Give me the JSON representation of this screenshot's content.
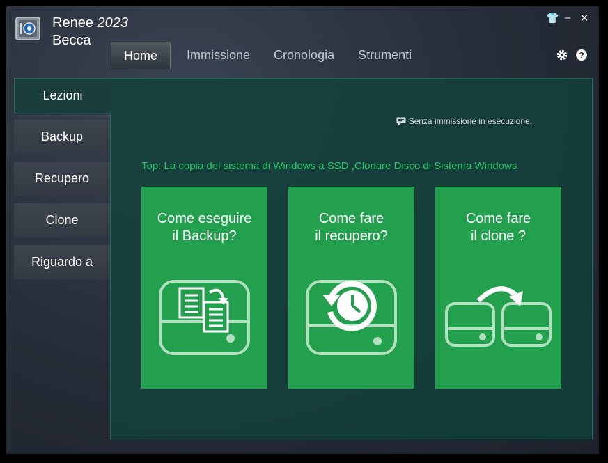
{
  "app": {
    "name_line1": "Renee",
    "version": "2023",
    "name_line2": "Becca"
  },
  "window_controls": {
    "shirt": "👕",
    "minimize": "–",
    "close": "✕"
  },
  "tabs": [
    {
      "label": "Home",
      "active": true
    },
    {
      "label": "Immissione"
    },
    {
      "label": "Cronologia"
    },
    {
      "label": "Strumenti"
    }
  ],
  "sidebar": {
    "header": "Lezioni",
    "items": [
      {
        "label": "Backup"
      },
      {
        "label": "Recupero"
      },
      {
        "label": "Clone"
      },
      {
        "label": "Riguardo a"
      }
    ]
  },
  "status": {
    "text": "Senza immissione in esecuzione."
  },
  "top_line": "Top: La copia del sistema di Windows a SSD ,Clonare Disco di Sistema Windows",
  "cards": [
    {
      "line1": "Come eseguire",
      "line2": "il Backup?",
      "icon": "backup-drive-icon"
    },
    {
      "line1": "Come fare",
      "line2": "il recupero?",
      "icon": "restore-drive-icon"
    },
    {
      "line1": "Come fare",
      "line2": "il clone ?",
      "icon": "clone-drives-icon"
    }
  ],
  "colors": {
    "accent_green": "#23a04e",
    "panel_teal": "#13403a",
    "link_green": "#1ecb6b"
  }
}
